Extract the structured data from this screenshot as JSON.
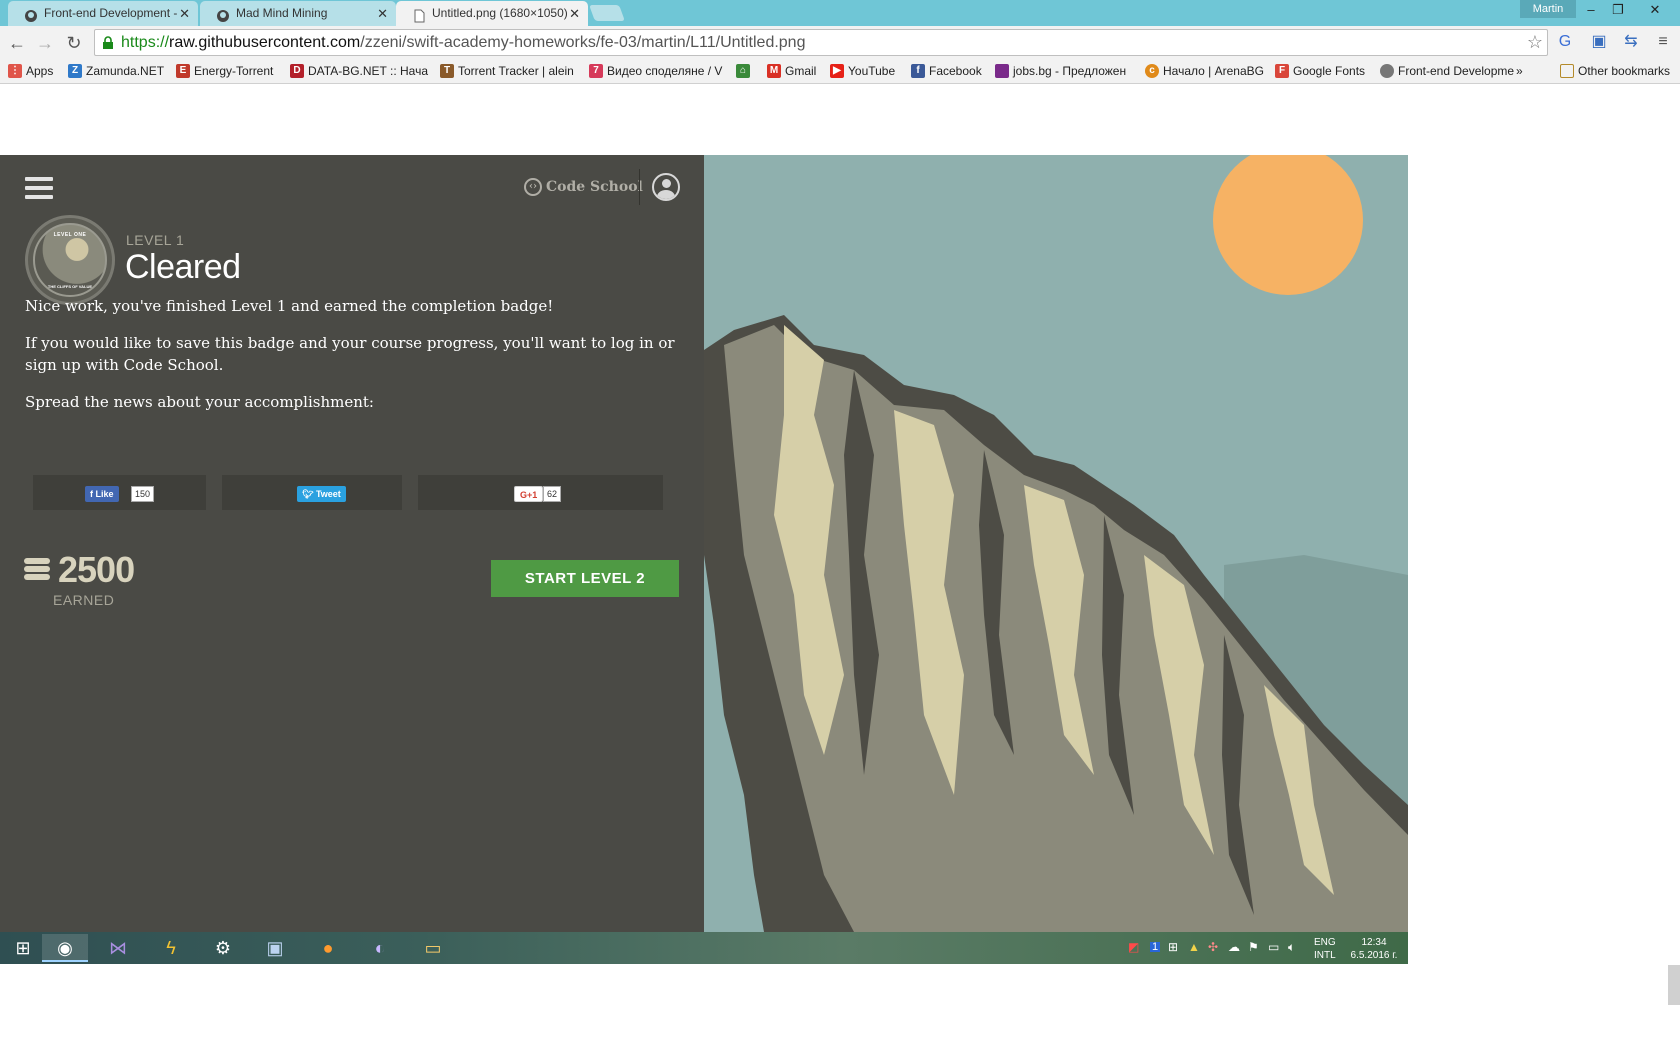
{
  "tabs": [
    {
      "label": "Front-end Development -",
      "state": "inactive"
    },
    {
      "label": "Mad Mind Mining",
      "state": "inactive"
    },
    {
      "label": "Untitled.png (1680×1050)",
      "state": "active"
    }
  ],
  "window": {
    "user": "Martin"
  },
  "address": {
    "scheme": "https://",
    "host": "raw.githubusercontent.com",
    "path": "/zzeni/swift-academy-homeworks/fe-03/martin/L11/Untitled.png"
  },
  "bookmarks": [
    {
      "label": "Apps",
      "icon": "apps-grid-icon",
      "color": "#e0554a"
    },
    {
      "label": "Zamunda.NET",
      "icon": "zamunda-icon",
      "color": "#2f79c9"
    },
    {
      "label": "Energy-Torrent",
      "icon": "energy-icon",
      "color": "#c0392b"
    },
    {
      "label": "DATA-BG.NET :: Нача",
      "icon": "databg-icon",
      "color": "#b3202a"
    },
    {
      "label": "Torrent Tracker | alein",
      "icon": "tracker-icon",
      "color": "#8a5a2a"
    },
    {
      "label": "Видео споделяне / V",
      "icon": "video-icon",
      "color": "#d63a5a"
    },
    {
      "label": "",
      "icon": "home-icon",
      "color": "#3a8a3a"
    },
    {
      "label": "Gmail",
      "icon": "gmail-icon",
      "color": "#d93025"
    },
    {
      "label": "YouTube",
      "icon": "youtube-icon",
      "color": "#e62117"
    },
    {
      "label": "Facebook",
      "icon": "facebook-icon",
      "color": "#3b5998"
    },
    {
      "label": "jobs.bg - Предложен",
      "icon": "jobsbg-icon",
      "color": "#7a2a8a"
    },
    {
      "label": "Начало | ArenaBG",
      "icon": "arenabg-icon",
      "color": "#e08a1a"
    },
    {
      "label": "Google Fonts",
      "icon": "googlefonts-icon",
      "color": "#d9463a"
    },
    {
      "label": "Front-end Developme",
      "icon": "frontend-icon",
      "color": "#777777"
    }
  ],
  "bookmarks_more": "»",
  "other_bookmarks": "Other bookmarks",
  "page": {
    "brand": "Code School",
    "level_label": "LEVEL 1",
    "status": "Cleared",
    "badge_top": "LEVEL ONE",
    "badge_bottom": "THE CLIFFS OF VALUE",
    "message1": "Nice work, you've finished Level 1 and earned the completion badge!",
    "message2": "If you would like to save this badge and your course progress, you'll want to log in or sign up with Code School.",
    "message3": "Spread the news about your accomplishment:",
    "share": {
      "like_label": "Like",
      "like_count": "150",
      "tweet_label": "Tweet",
      "gplus_label": "G+1",
      "gplus_count": "62"
    },
    "points": "2500",
    "points_label": "EARNED",
    "start_button": "START LEVEL 2"
  },
  "taskbar": {
    "apps": [
      "start-icon",
      "chrome-icon",
      "visual-studio-icon",
      "winamp-icon",
      "steam-icon",
      "virtualbox-icon",
      "ubuntu-icon",
      "cat-icon",
      "folder-icon"
    ],
    "lang_top": "ENG",
    "lang_bottom": "INTL",
    "time": "12:34",
    "date": "6.5.2016 г."
  },
  "colors": {
    "panel": "#4a4a45",
    "sky": "#8fb0ae",
    "sun": "#f6b264",
    "start_button": "#4f9a44",
    "titlebar": "#6fc6d6"
  }
}
